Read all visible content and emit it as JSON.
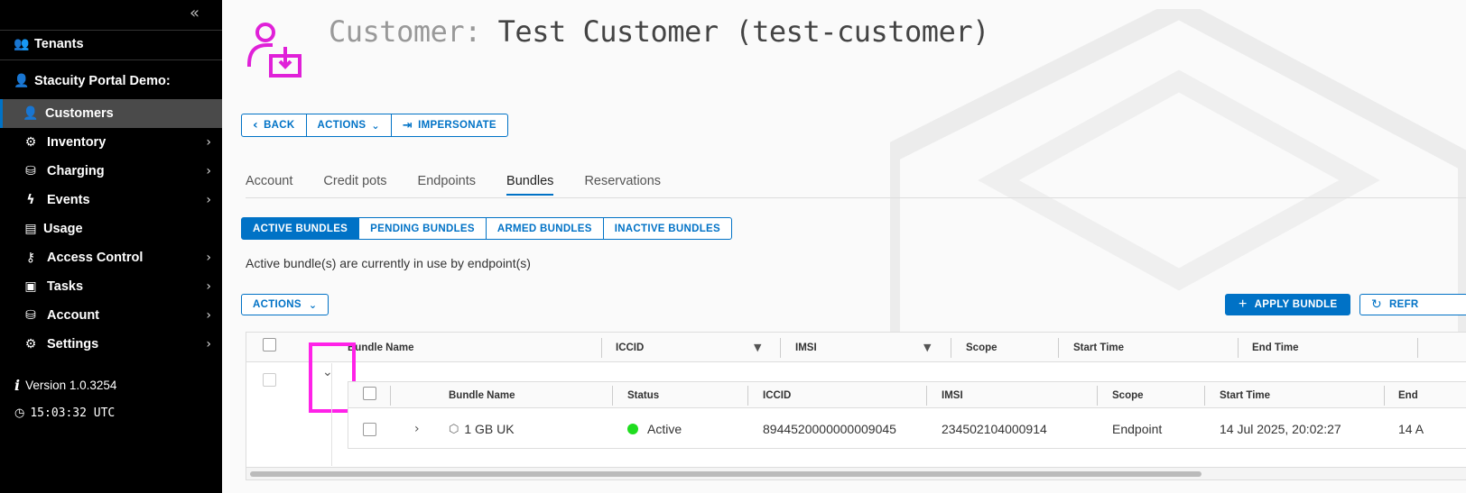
{
  "sidebar": {
    "collapse_icon": "double-chevron-left-icon",
    "tenants": {
      "label": "Tenants",
      "icon": "tenants-icon"
    },
    "org": {
      "label": "Stacuity Portal Demo:",
      "icon": "org-user-icon"
    },
    "items": [
      {
        "label": "Customers",
        "icon": "customer-icon",
        "active": true,
        "chevron": false,
        "icon_color": "#6ed24a"
      },
      {
        "label": "Inventory",
        "icon": "inventory-icon",
        "chevron": true
      },
      {
        "label": "Charging",
        "icon": "charging-icon",
        "chevron": true
      },
      {
        "label": "Events",
        "icon": "bolt-icon",
        "chevron": true
      },
      {
        "label": "Usage",
        "icon": "usage-icon",
        "chevron": false
      },
      {
        "label": "Access Control",
        "icon": "key-icon",
        "chevron": true
      },
      {
        "label": "Tasks",
        "icon": "clipboard-icon",
        "chevron": true
      },
      {
        "label": "Account",
        "icon": "account-icon",
        "chevron": true
      },
      {
        "label": "Settings",
        "icon": "gear-icon",
        "chevron": true
      }
    ],
    "version": "Version 1.0.3254",
    "clock": "15:03:32 UTC"
  },
  "header": {
    "title_prefix": "Customer:",
    "title_value": " Test Customer (test-customer)",
    "icon": "customer-card-icon",
    "icon_color": "#e020d8"
  },
  "toolbar": {
    "back": "BACK",
    "actions": "ACTIONS",
    "impersonate": "IMPERSONATE"
  },
  "tabs": [
    "Account",
    "Credit pots",
    "Endpoints",
    "Bundles",
    "Reservations"
  ],
  "selected_tab": "Bundles",
  "bundle_filters": {
    "active": "ACTIVE BUNDLES",
    "pending": "PENDING BUNDLES",
    "armed": "ARMED BUNDLES",
    "inactive": "INACTIVE BUNDLES"
  },
  "description": "Active bundle(s) are currently in use by endpoint(s)",
  "grid_actions": "ACTIONS",
  "apply_bundle": "APPLY BUNDLE",
  "refresh": "REFR",
  "outer_columns": [
    "Bundle Name",
    "ICCID",
    "IMSI",
    "Scope",
    "Start Time",
    "End Time"
  ],
  "inner_columns": [
    "Bundle Name",
    "Status",
    "ICCID",
    "IMSI",
    "Scope",
    "Start Time",
    "End"
  ],
  "inner_row": {
    "bundle_name": "1 GB UK",
    "status": "Active",
    "iccid": "8944520000000009045",
    "imsi": "234502104000914",
    "scope": "Endpoint",
    "start_time": "14 Jul 2025, 20:02:27",
    "end_time": "14 A"
  },
  "colors": {
    "accent": "#0072c6",
    "highlight": "#ff22e8",
    "active_status": "#1fdd1f"
  }
}
